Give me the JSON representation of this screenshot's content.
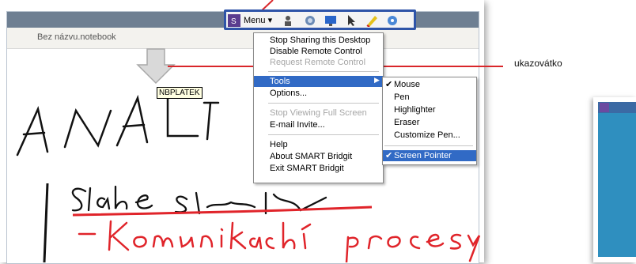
{
  "app": {
    "document_title": "Bez názvu.notebook"
  },
  "toolbar": {
    "menu_label": "Menu ▾",
    "icons": [
      "smart-logo-icon",
      "user-icon",
      "globe-icon",
      "monitor-icon",
      "pointer-icon",
      "pen-icon",
      "settings-icon"
    ]
  },
  "menu": {
    "items": [
      {
        "label": "Stop Sharing this Desktop",
        "enabled": true
      },
      {
        "label": "Disable Remote Control",
        "enabled": true
      },
      {
        "label": "Request Remote Control",
        "enabled": false
      },
      {
        "label": "Tools",
        "enabled": true,
        "has_submenu": true,
        "highlighted": true
      },
      {
        "label": "Options...",
        "enabled": true
      },
      {
        "label": "Stop Viewing Full Screen",
        "enabled": false
      },
      {
        "label": "E-mail Invite...",
        "enabled": true
      },
      {
        "label": "Help",
        "enabled": true
      },
      {
        "label": "About SMART Bridgit",
        "enabled": true
      },
      {
        "label": "Exit SMART Bridgit",
        "enabled": true
      }
    ]
  },
  "submenu": {
    "items": [
      {
        "label": "Mouse",
        "checked": true
      },
      {
        "label": "Pen",
        "checked": false
      },
      {
        "label": "Highlighter",
        "checked": false
      },
      {
        "label": "Eraser",
        "checked": false
      },
      {
        "label": "Customize Pen...",
        "checked": false
      },
      {
        "label": "Screen Pointer",
        "checked": true,
        "highlighted": true
      }
    ]
  },
  "tooltip": {
    "text": "NBPLATEK"
  },
  "callout": {
    "label": "ukazovátko"
  },
  "colors": {
    "menu_highlight": "#316ac5",
    "toolbar_border": "#2e54a8",
    "annotation": "#d9262a",
    "ink_red": "#e0242a",
    "ink_black": "#111111"
  }
}
